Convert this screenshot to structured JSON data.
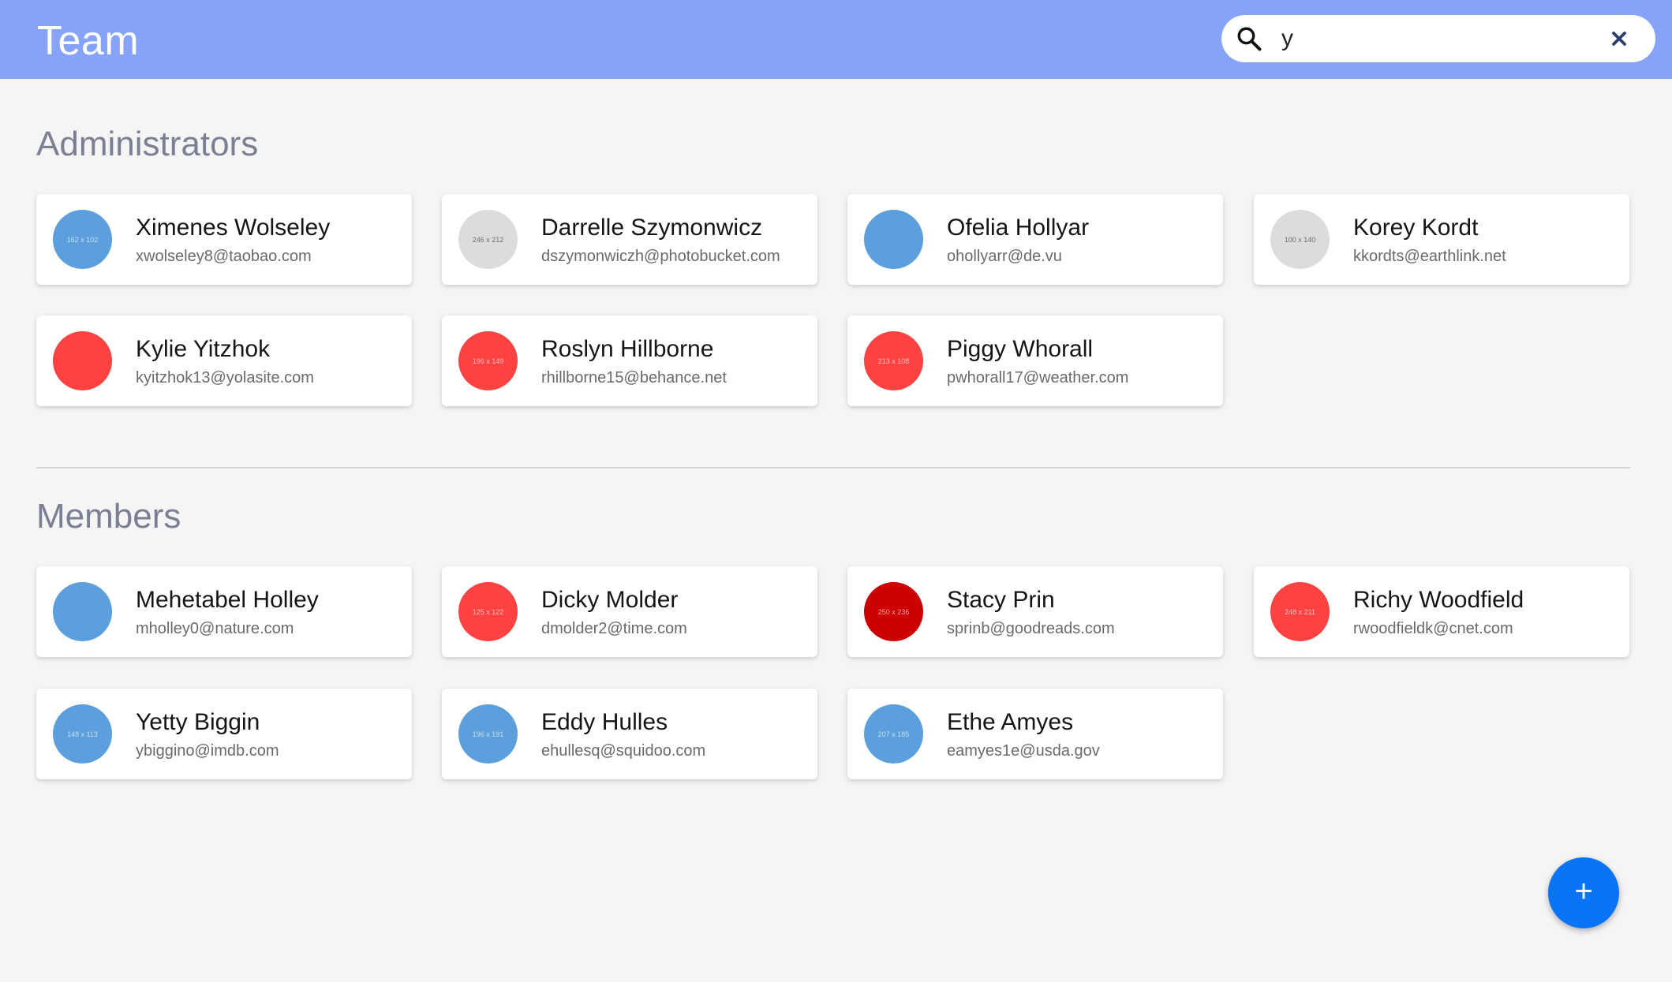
{
  "header": {
    "title": "Team",
    "search": {
      "value": "y",
      "placeholder": "",
      "icon": "search-icon",
      "clear_icon": "close-icon"
    },
    "background": "#87a3f7"
  },
  "sections": [
    {
      "title": "Administrators",
      "users": [
        {
          "name": "Ximenes Wolseley",
          "email": "xwolseley8@taobao.com",
          "avatar_label": "162 x 102",
          "avatar_color": "#5b9fdc"
        },
        {
          "name": "Darrelle Szymonwicz",
          "email": "dszymonwiczh@photobucket.com",
          "avatar_label": "246 x 212",
          "avatar_color": "#dcdcdc"
        },
        {
          "name": "Ofelia Hollyar",
          "email": "ohollyarr@de.vu",
          "avatar_label": "",
          "avatar_color": "#5b9fdc"
        },
        {
          "name": "Korey Kordt",
          "email": "kkordts@earthlink.net",
          "avatar_label": "100 x 140",
          "avatar_color": "#dcdcdc"
        },
        {
          "name": "Kylie Yitzhok",
          "email": "kyitzhok13@yolasite.com",
          "avatar_label": "",
          "avatar_color": "#fe4242"
        },
        {
          "name": "Roslyn Hillborne",
          "email": "rhillborne15@behance.net",
          "avatar_label": "196 x 149",
          "avatar_color": "#fe4242"
        },
        {
          "name": "Piggy Whorall",
          "email": "pwhorall17@weather.com",
          "avatar_label": "213 x 108",
          "avatar_color": "#fe4242"
        }
      ]
    },
    {
      "title": "Members",
      "users": [
        {
          "name": "Mehetabel Holley",
          "email": "mholley0@nature.com",
          "avatar_label": "",
          "avatar_color": "#5b9fdc"
        },
        {
          "name": "Dicky Molder",
          "email": "dmolder2@time.com",
          "avatar_label": "125 x 122",
          "avatar_color": "#fe4242"
        },
        {
          "name": "Stacy Prin",
          "email": "sprinb@goodreads.com",
          "avatar_label": "250 x 236",
          "avatar_color": "#cc0000"
        },
        {
          "name": "Richy Woodfield",
          "email": "rwoodfieldk@cnet.com",
          "avatar_label": "248 x 211",
          "avatar_color": "#fe4242"
        },
        {
          "name": "Yetty Biggin",
          "email": "ybiggino@imdb.com",
          "avatar_label": "148 x 113",
          "avatar_color": "#5b9fdc"
        },
        {
          "name": "Eddy Hulles",
          "email": "ehullesq@squidoo.com",
          "avatar_label": "196 x 191",
          "avatar_color": "#5b9fdc"
        },
        {
          "name": "Ethe Amyes",
          "email": "eamyes1e@usda.gov",
          "avatar_label": "207 x 185",
          "avatar_color": "#5b9fdc"
        }
      ]
    }
  ],
  "fab": {
    "label": "+",
    "color": "#0b73f5"
  }
}
